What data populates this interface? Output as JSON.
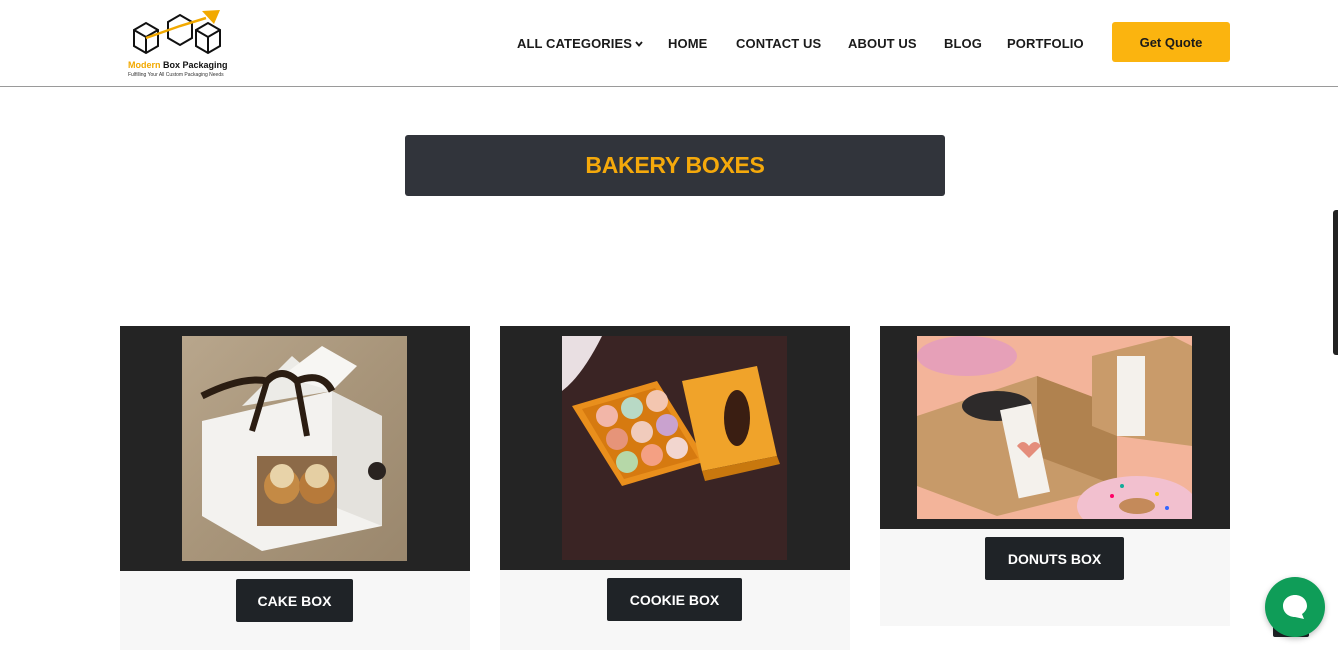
{
  "brand": {
    "name_accent": "Modern",
    "name_rest": " Box Packaging",
    "tagline": "Fulfilling Your All Custom Packaging Needs",
    "accent_color": "#f2a900"
  },
  "nav": {
    "items": [
      {
        "label": "ALL CATEGORIES",
        "has_dropdown": true
      },
      {
        "label": "HOME"
      },
      {
        "label": "CONTACT US"
      },
      {
        "label": "ABOUT US"
      },
      {
        "label": "BLOG"
      },
      {
        "label": "PORTFOLIO"
      }
    ],
    "cta_label": "Get Quote",
    "cta_color": "#fbb40f"
  },
  "page": {
    "title": "BAKERY BOXES",
    "title_color": "#f5a90b",
    "title_bg": "#31343b"
  },
  "products": [
    {
      "label": "CAKE BOX",
      "image": "white gable cake box with ribbon and cupcakes"
    },
    {
      "label": "COOKIE BOX",
      "image": "orange macaron box with lid"
    },
    {
      "label": "DONUTS BOX",
      "image": "kraft donut boxes with love and donuts labels"
    }
  ],
  "widgets": {
    "chat_icon": "chat-bubble-icon",
    "chat_color": "#0f9d58"
  }
}
